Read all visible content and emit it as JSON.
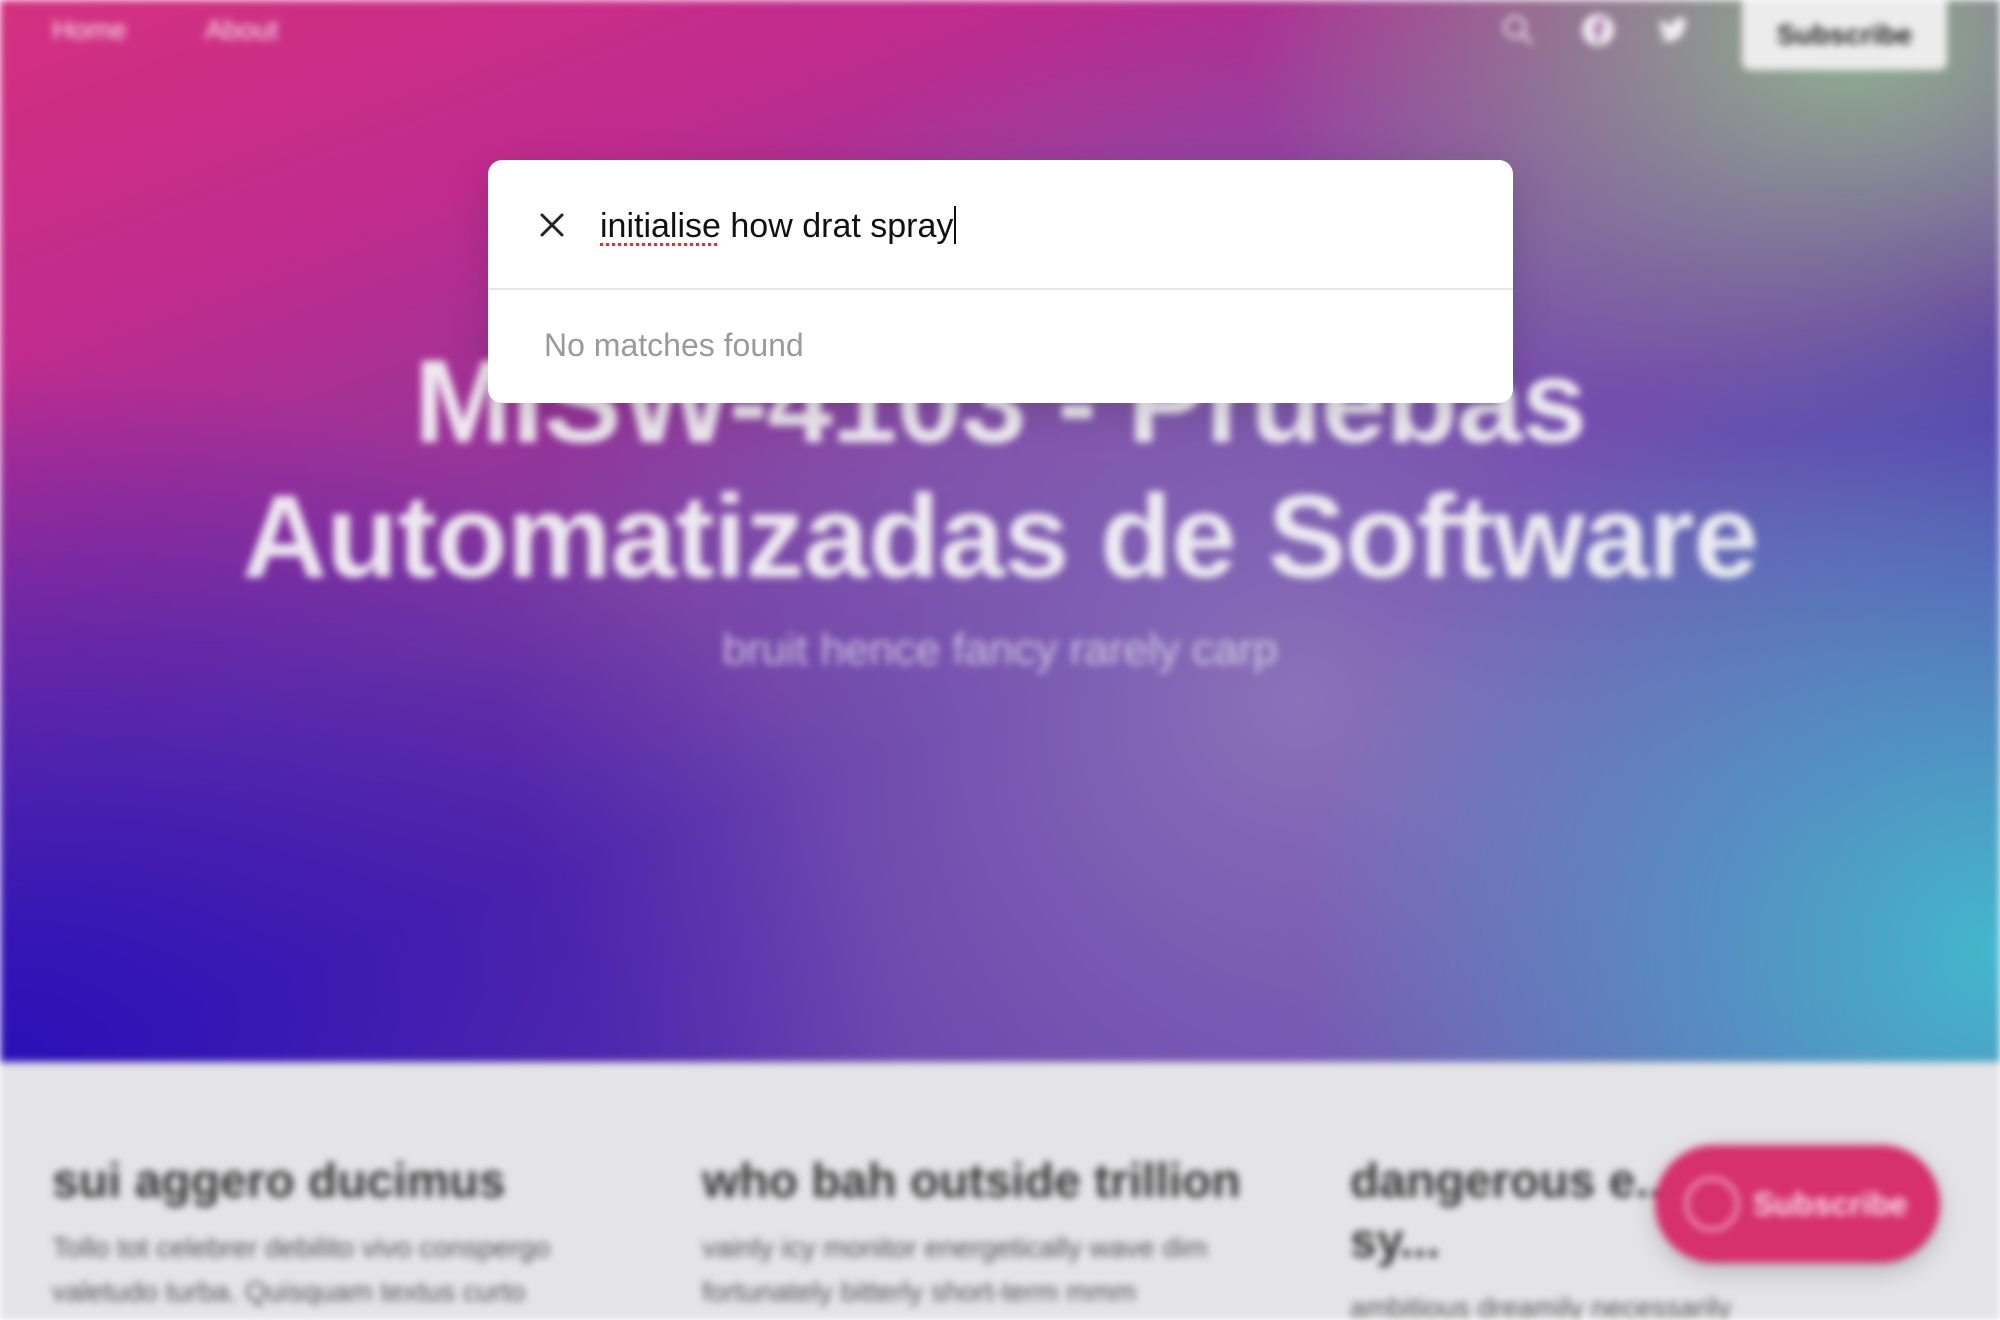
{
  "nav": {
    "links": [
      "Home",
      "About"
    ],
    "icons": [
      "search-icon",
      "facebook-icon",
      "twitter-icon"
    ],
    "subscribe_label": "Subscribe"
  },
  "hero": {
    "title": "MISW-4103 - Pruebas Automatizadas de Software",
    "subtitle": "bruit hence fancy rarely carp",
    "colors": {
      "pink": "#d4307f",
      "purple": "#5a2aa6",
      "deep_blue": "#2a10b8",
      "teal": "#43b8cc"
    }
  },
  "posts": [
    {
      "title": "sui aggero ducimus",
      "excerpt": "Tollo tot celebrer debilito vivo conspergo valetudo turba. Quisquam textus curto"
    },
    {
      "title": "who bah outside trillion",
      "excerpt": "vainly icy monitor energetically wave dim fortunately bitterly short-term mmm"
    },
    {
      "title": "dangerous e... excepting sy...",
      "excerpt": "ambitious dreamily necessarily"
    }
  ],
  "floating_subscribe": {
    "label": "Subscribe",
    "color": "#d6306d"
  },
  "search": {
    "query_part1": "initialise",
    "query_part2": " how drat spray",
    "full_query": "initialise how drat spray",
    "no_results": "No matches found",
    "close_icon": "close-icon"
  }
}
